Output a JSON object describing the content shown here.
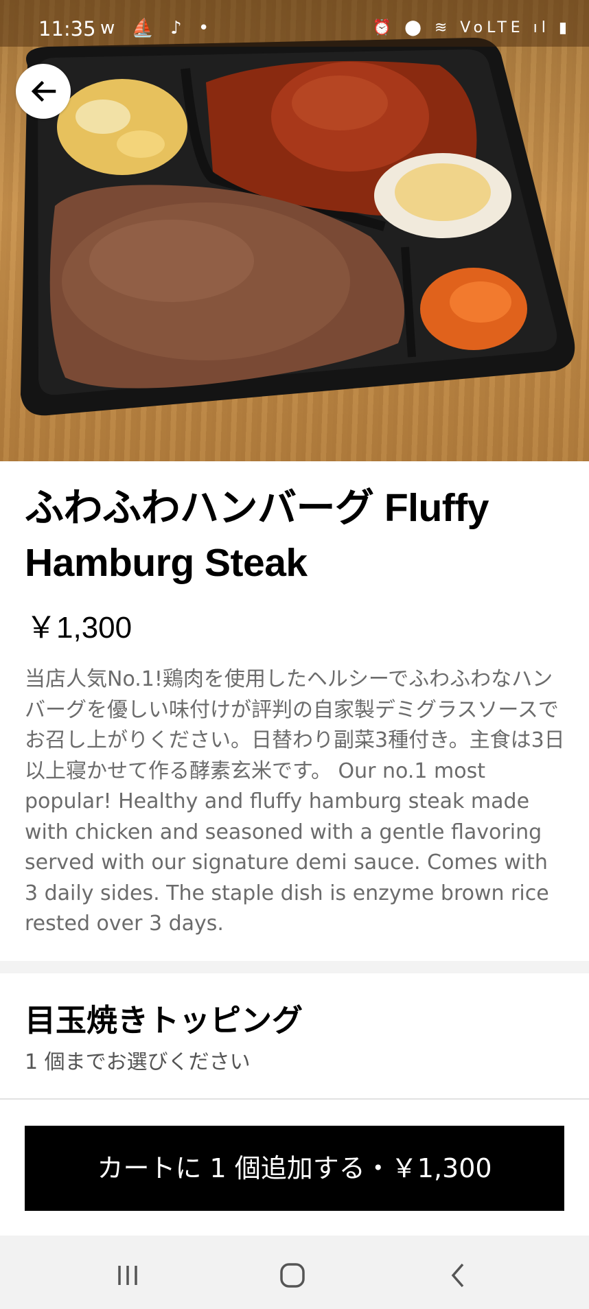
{
  "status_bar": {
    "time": "11:35",
    "app_icons": "w ⛵ ♪ •",
    "system_icons": "⏰ ⬤ ≋ VoLTE ıl ▮"
  },
  "hero": {
    "alt": "bento box with hamburg steak, brown rice, sides"
  },
  "item": {
    "title": "ふわふわハンバーグ Fluffy Hamburg Steak",
    "price": "￥1,300",
    "description": "当店人気No.1!鶏肉を使用したヘルシーでふわふわなハンバーグを優しい味付けが評判の自家製デミグラスソースでお召し上がりください。日替わり副菜3種付き。主食は3日以上寝かせて作る酵素玄米です。 Our no.1 most popular! Healthy and fluffy hamburg steak made with chicken and seasoned with a gentle flavoring served with our signature demi sauce. Comes with 3 daily sides. The staple dish is enzyme brown rice rested over 3 days."
  },
  "option_group": {
    "title": "目玉焼きトッピング",
    "subtitle": "1 個までお選びください"
  },
  "cart_button": {
    "label": "カートに 1 個追加する・￥1,300"
  },
  "icons": {
    "back": "arrow-left",
    "nav_recents": "recents",
    "nav_home": "home",
    "nav_back": "chevron-left"
  }
}
